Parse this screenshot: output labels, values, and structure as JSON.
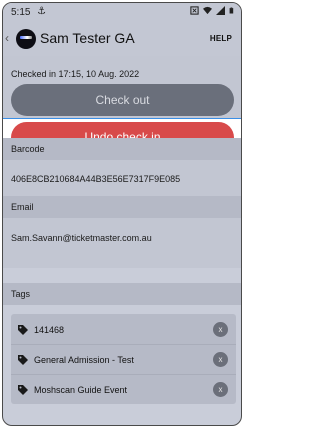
{
  "status_bar": {
    "time": "5:15",
    "usb_icon": "usb-icon",
    "icons": [
      "nfc-icon",
      "wifi-icon",
      "signal-icon",
      "battery-icon"
    ]
  },
  "app_bar": {
    "back_icon": "chevron-left-icon",
    "logo_icon": "event-logo",
    "title": "Sam Tester GA",
    "help_label": "HELP"
  },
  "checkin": {
    "status_text": "Checked in 17:15, 10 Aug. 2022",
    "checkout_label": "Check out",
    "undo_label": "Undo check in"
  },
  "barcode": {
    "header": "Barcode",
    "value": "406E8CB210684A44B3E56E7317F9E085"
  },
  "email": {
    "header": "Email",
    "value": "Sam.Savann@ticketmaster.com.au"
  },
  "tags": {
    "header": "Tags",
    "items": [
      {
        "label": "141468",
        "icon": "tag-icon",
        "remove": "x"
      },
      {
        "label": "General Admission - Test",
        "icon": "tag-icon",
        "remove": "x"
      },
      {
        "label": "Moshscan Guide Event",
        "icon": "tag-icon",
        "remove": "x"
      }
    ]
  },
  "colors": {
    "overlay": "#c9cdd9",
    "checkout_button": "#6a6f7b",
    "undo_button": "#d84a4a",
    "focus_border": "#3a8ee6"
  }
}
